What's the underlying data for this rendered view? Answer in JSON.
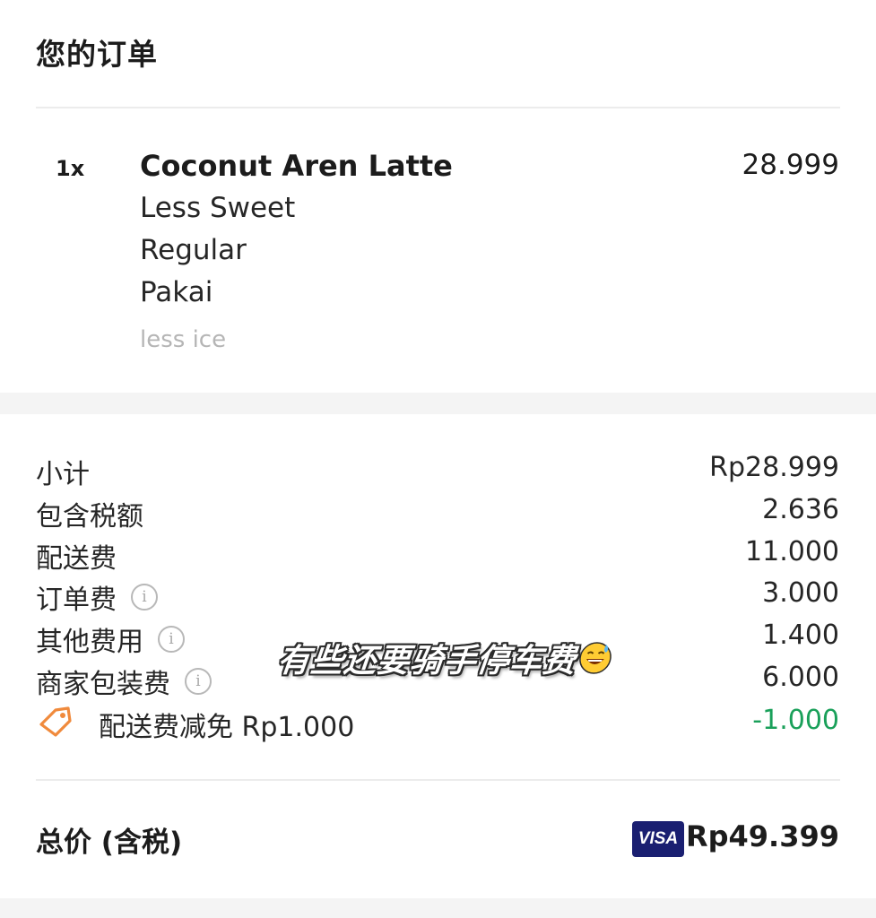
{
  "header": {
    "title": "您的订单"
  },
  "item": {
    "quantity": "1x",
    "name": "Coconut Aren Latte",
    "price": "28.999",
    "options": [
      "Less Sweet",
      "Regular",
      "Pakai"
    ],
    "note": "less ice"
  },
  "summary": {
    "subtotal": {
      "label": "小计",
      "value": "Rp28.999"
    },
    "tax": {
      "label": "包含税额",
      "value": "2.636"
    },
    "delivery": {
      "label": "配送费",
      "value": "11.000"
    },
    "order_fee": {
      "label": "订单费",
      "value": "3.000",
      "icon": "info-icon"
    },
    "other_fee": {
      "label": "其他费用",
      "value": "1.400",
      "icon": "info-icon"
    },
    "packaging_fee": {
      "label": "商家包装费",
      "value": "6.000",
      "icon": "info-icon"
    },
    "discount": {
      "label": "配送费减免 Rp1.000",
      "value": "-1.000",
      "icon": "tag-icon",
      "color": "#1aa05a"
    }
  },
  "overlay": {
    "sticker_text": "有些还要骑手停车费",
    "emoji": "sweat-smile-emoji"
  },
  "total": {
    "label": "总价 (含税)",
    "payment_badge": "VISA",
    "value": "Rp49.399"
  },
  "colors": {
    "accent_tag": "#f08a3c",
    "visa": "#1a1f71",
    "discount": "#1aa05a"
  }
}
